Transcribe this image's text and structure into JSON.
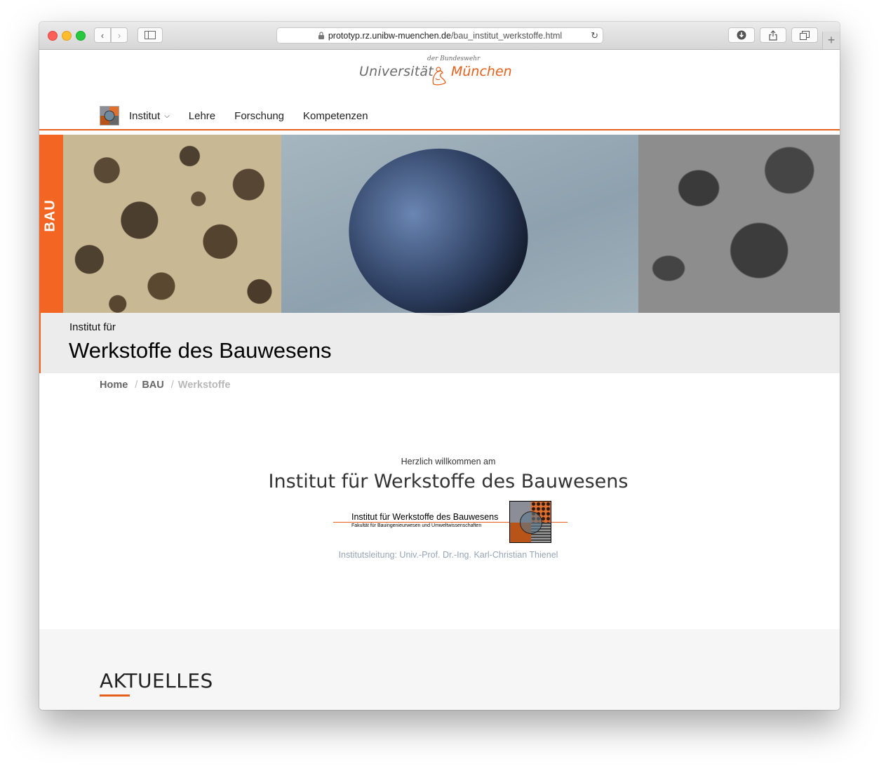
{
  "browser": {
    "url_host": "prototyp.rz.unibw-muenchen.de",
    "url_path": "/bau_institut_werkstoffe.html"
  },
  "logo": {
    "subtitle": "der Bundeswehr",
    "left": "Universität",
    "right": "München"
  },
  "nav": {
    "items": [
      {
        "label": "Institut"
      },
      {
        "label": "Lehre"
      },
      {
        "label": "Forschung"
      },
      {
        "label": "Kompetenzen"
      }
    ]
  },
  "hero": {
    "tab_label": "BAU",
    "pretitle": "Institut für",
    "title": "Werkstoffe des Bauwesens"
  },
  "breadcrumb": {
    "home": "Home",
    "section": "BAU",
    "current": "Werkstoffe",
    "separator": "/"
  },
  "intro": {
    "welcome": "Herzlich willkommen am",
    "title": "Institut für Werkstoffe des Bauwesens",
    "logo_line1": "Institut für Werkstoffe des Bauwesens",
    "logo_line2": "Fakultät für Bauingenieurwesen und Umweltwissenschaften",
    "leader": "Institutsleitung: Univ.-Prof. Dr.-Ing. Karl-Christian Thienel"
  },
  "news": {
    "title": "AKTUELLES"
  },
  "colors": {
    "accent": "#e5601b",
    "tab": "#f26522"
  }
}
